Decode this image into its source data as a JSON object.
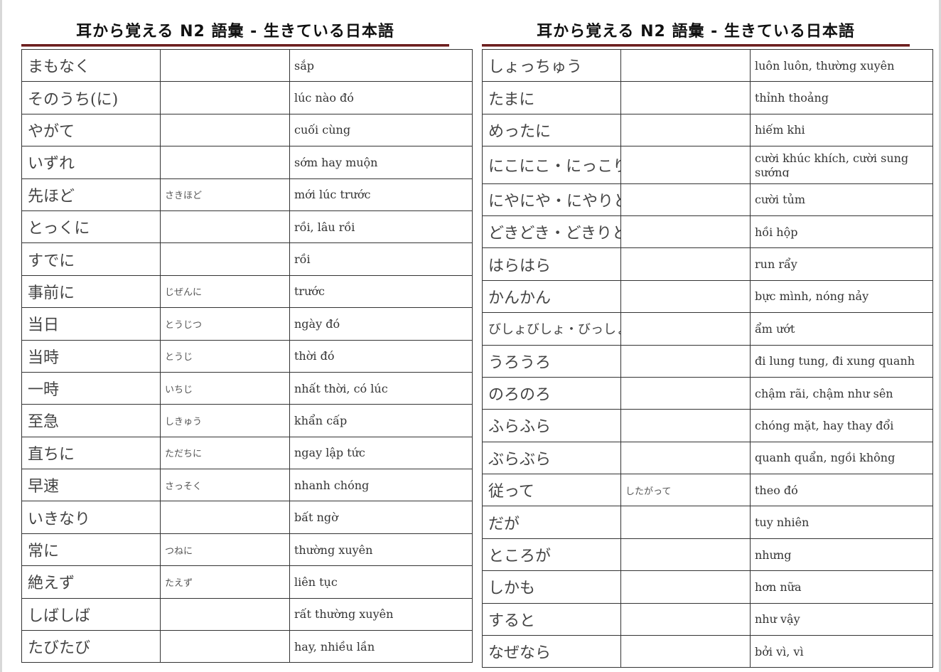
{
  "left_column": {
    "title": "耳から覚える N2 語彙 - 生きている日本語",
    "rows": [
      {
        "word": "まもなく",
        "reading": "",
        "meaning": "sắp"
      },
      {
        "word": "そのうち(に)",
        "reading": "",
        "meaning": "lúc nào đó"
      },
      {
        "word": "やがて",
        "reading": "",
        "meaning": "cuối cùng"
      },
      {
        "word": "いずれ",
        "reading": "",
        "meaning": "sớm hay muộn"
      },
      {
        "word": "先ほど",
        "reading": "さきほど",
        "meaning": "mới lúc trước"
      },
      {
        "word": "とっくに",
        "reading": "",
        "meaning": "rồi, lâu rồi"
      },
      {
        "word": "すでに",
        "reading": "",
        "meaning": "rồi"
      },
      {
        "word": "事前に",
        "reading": "じぜんに",
        "meaning": "trước"
      },
      {
        "word": "当日",
        "reading": "とうじつ",
        "meaning": "ngày đó"
      },
      {
        "word": "当時",
        "reading": "とうじ",
        "meaning": "thời đó"
      },
      {
        "word": "一時",
        "reading": "いちじ",
        "meaning": "nhất thời, có lúc"
      },
      {
        "word": "至急",
        "reading": "しきゅう",
        "meaning": "khẩn cấp"
      },
      {
        "word": "直ちに",
        "reading": "ただちに",
        "meaning": "ngay lập tức"
      },
      {
        "word": "早速",
        "reading": "さっそく",
        "meaning": "nhanh chóng"
      },
      {
        "word": "いきなり",
        "reading": "",
        "meaning": "bất ngờ"
      },
      {
        "word": "常に",
        "reading": "つねに",
        "meaning": "thường xuyên"
      },
      {
        "word": "絶えず",
        "reading": "たえず",
        "meaning": "liên tục"
      },
      {
        "word": "しばしば",
        "reading": "",
        "meaning": "rất thường xuyên"
      },
      {
        "word": "たびたび",
        "reading": "",
        "meaning": "hay, nhiều lần"
      }
    ]
  },
  "right_column": {
    "title": "耳から覚える N2 語彙 - 生きている日本語",
    "rows": [
      {
        "word": "しょっちゅう",
        "reading": "",
        "meaning": "luôn luôn, thường xuyên"
      },
      {
        "word": "たまに",
        "reading": "",
        "meaning": "thỉnh thoảng"
      },
      {
        "word": "めったに",
        "reading": "",
        "meaning": "hiếm khi"
      },
      {
        "word": "にこにこ・にっこり",
        "reading": "",
        "meaning": "cười khúc khích, cười sung sướng"
      },
      {
        "word": "にやにや・にやりと",
        "reading": "",
        "meaning": "cười tủm"
      },
      {
        "word": "どきどき・どきりと",
        "reading": "",
        "meaning": "hồi hộp"
      },
      {
        "word": "はらはら",
        "reading": "",
        "meaning": "run rẩy"
      },
      {
        "word": "かんかん",
        "reading": "",
        "meaning": "bực mình, nóng nảy"
      },
      {
        "word": "びしょびしょ・びっしょり",
        "reading": "",
        "meaning": "ẩm ướt"
      },
      {
        "word": "うろうろ",
        "reading": "",
        "meaning": "đi lung tung, đi xung quanh"
      },
      {
        "word": "のろのろ",
        "reading": "",
        "meaning": "chậm rãi, chậm như sên"
      },
      {
        "word": "ふらふら",
        "reading": "",
        "meaning": "chóng mặt, hay thay đổi"
      },
      {
        "word": "ぶらぶら",
        "reading": "",
        "meaning": "quanh quẩn, ngồi không"
      },
      {
        "word": "従って",
        "reading": "したがって",
        "meaning": "theo đó"
      },
      {
        "word": "だが",
        "reading": "",
        "meaning": "tuy nhiên"
      },
      {
        "word": "ところが",
        "reading": "",
        "meaning": "nhưng"
      },
      {
        "word": "しかも",
        "reading": "",
        "meaning": "hơn nữa"
      },
      {
        "word": "すると",
        "reading": "",
        "meaning": "như vậy"
      },
      {
        "word": "なぜなら",
        "reading": "",
        "meaning": "bởi vì, vì"
      }
    ]
  }
}
